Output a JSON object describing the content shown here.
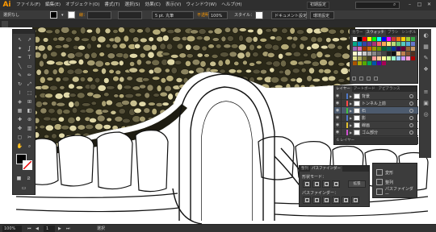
{
  "app": {
    "logo": "Ai",
    "accent": "#ff9a00"
  },
  "menu": [
    "ファイル(F)",
    "編集(E)",
    "オブジェクト(O)",
    "書式(T)",
    "選択(S)",
    "効果(C)",
    "表示(V)",
    "ウィンドウ(W)",
    "ヘルプ(H)"
  ],
  "window": {
    "workspace": "初期設定",
    "minimize": "–",
    "maximize": "□",
    "close": "✕"
  },
  "control": {
    "selection_label": "選択なし",
    "stroke_label": "線：",
    "brush_label": "5 pt. 丸筆",
    "opacity_label": "不透明度：",
    "opacity_value": "100%",
    "style_label": "スタイル：",
    "doc_settings": "ドキュメント設定",
    "prefs": "環境設定"
  },
  "document_tab": "",
  "tools": {
    "icons": [
      "selection-icon",
      "direct-selection-icon",
      "magic-wand-icon",
      "lasso-icon",
      "pen-icon",
      "type-icon",
      "line-icon",
      "rectangle-icon",
      "brush-icon",
      "pencil-icon",
      "rotate-icon",
      "scale-icon",
      "warp-icon",
      "free-transform-icon",
      "shape-builder-icon",
      "perspective-icon",
      "mesh-icon",
      "gradient-icon",
      "eyedropper-icon",
      "blend-icon",
      "symbol-icon",
      "graph-icon",
      "artboard-icon",
      "slice-icon",
      "hand-icon",
      "zoom-icon"
    ]
  },
  "swatches": {
    "tabs": [
      "カラー",
      "スウォッチ",
      "ブラシ",
      "シンボル"
    ],
    "active_tab": 1,
    "colors": [
      "#ffffff",
      "#000000",
      "#ff0000",
      "#ffff00",
      "#00ff00",
      "#00ffff",
      "#0000ff",
      "#ff00ff",
      "#cc3333",
      "#ee7711",
      "#ffcc00",
      "#99cc33",
      "#33aa44",
      "#00aa88",
      "#0088cc",
      "#3344aa",
      "#663399",
      "#aa3377",
      "#ff6666",
      "#ffaa55",
      "#ffee77",
      "#bbdd77",
      "#66cc77",
      "#55ccbb",
      "#55aadd",
      "#6677cc",
      "#9966bb",
      "#dd66aa",
      "#993300",
      "#cc6600",
      "#999900",
      "#669900",
      "#006633",
      "#006666",
      "#003399",
      "#330066",
      "#660033",
      "#996633",
      "#cc9966",
      "#ffffcc",
      "#eeeeee",
      "#cccccc",
      "#aaaaaa",
      "#888888",
      "#666666",
      "#444444",
      "#222222",
      "#111111",
      "#f0d0a0",
      "#c08050",
      "#805030",
      "#503020",
      "#e0e090",
      "#b0b060",
      "#707030",
      "#404020",
      "#ff9999",
      "#ffcc99",
      "#ffff99",
      "#ccff99",
      "#99ffcc",
      "#99ccff",
      "#cc99ff",
      "#ff99cc",
      "#aa0000",
      "#aa5500",
      "#aaaa00",
      "#55aa00",
      "#00aa55",
      "#0055aa",
      "#5500aa",
      "#aa0055"
    ]
  },
  "layers": {
    "tabs": [
      "レイヤー",
      "アートボード",
      "アピアランス"
    ],
    "rows": [
      {
        "name": "背景",
        "color": "#4f78c6",
        "selected": false
      },
      {
        "name": "トンネル上前",
        "color": "#ff4a4a",
        "selected": false
      },
      {
        "name": "石",
        "color": "#40c040",
        "selected": true
      },
      {
        "name": "影",
        "color": "#4f78c6",
        "selected": false
      },
      {
        "name": "線画",
        "color": "#e0c030",
        "selected": false
      },
      {
        "name": "ゴム部分",
        "color": "#d050d0",
        "selected": false
      }
    ],
    "footer": "6 レイヤー"
  },
  "pathfinder": {
    "tabs": [
      "整列",
      "パスファインダー"
    ],
    "shape_modes_label": "形状モード：",
    "pathfinders_label": "パスファインダー：",
    "expand": "拡張"
  },
  "mini_panel": {
    "items": [
      {
        "label": "変形",
        "icon": "transform-icon"
      },
      {
        "label": "整列",
        "icon": "align-icon"
      },
      {
        "label": "パスファインダー",
        "icon": "pathfinder-icon"
      }
    ]
  },
  "status": {
    "zoom": "100%",
    "page": "1",
    "tool": "選択"
  }
}
